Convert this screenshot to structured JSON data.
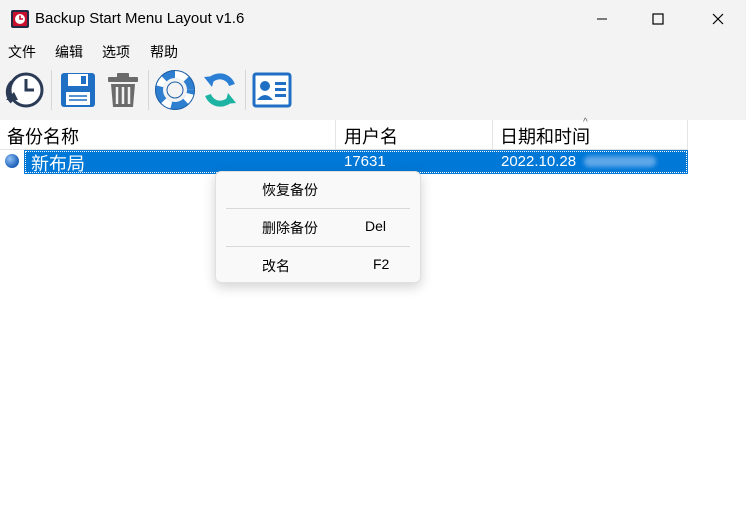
{
  "window": {
    "title": "Backup Start Menu Layout v1.6",
    "controls": [
      "minimize",
      "maximize",
      "close"
    ]
  },
  "menubar": {
    "items": [
      "文件",
      "编辑",
      "选项",
      "帮助"
    ]
  },
  "toolbar": {
    "buttons": [
      {
        "icon": "clock-backup-icon"
      },
      {
        "icon": "save-disk-icon"
      },
      {
        "icon": "trash-icon"
      },
      {
        "icon": "lifebuoy-icon"
      },
      {
        "icon": "refresh-icon"
      },
      {
        "icon": "contact-card-icon"
      }
    ]
  },
  "list": {
    "columns": [
      "备份名称",
      "用户名",
      "日期和时间"
    ],
    "rows": [
      {
        "name": "新布局",
        "user": "17631",
        "date": "2022.10.28",
        "selected": true
      }
    ]
  },
  "context_menu": {
    "items": [
      {
        "label": "恢复备份",
        "shortcut": ""
      },
      {
        "label": "删除备份",
        "shortcut": "Del"
      },
      {
        "label": "改名",
        "shortcut": "F2"
      }
    ]
  },
  "colors": {
    "selection": "#0078d7",
    "chrome": "#f3f3f3",
    "accent_red": "#c8102e",
    "icon_blue": "#1f6fc4"
  }
}
